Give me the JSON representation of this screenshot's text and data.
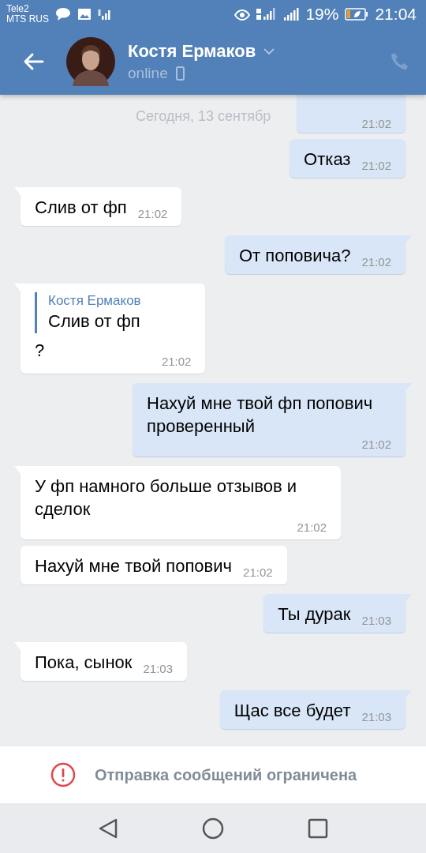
{
  "status_bar": {
    "carriers": [
      "Tele2",
      "MTS RUS"
    ],
    "battery": "19%",
    "time": "21:04"
  },
  "header": {
    "name": "Костя Ермаков",
    "status": "online"
  },
  "date_label": "Сегодня, 13 сентябр",
  "messages": [
    {
      "outgoing": true,
      "time": "21:02",
      "partial": true
    },
    {
      "outgoing": true,
      "text": "Отказ",
      "time": "21:02",
      "tail": false
    },
    {
      "outgoing": false,
      "text": "Слив от фп",
      "time": "21:02",
      "tail": true
    },
    {
      "outgoing": true,
      "text": "От поповича?",
      "time": "21:02",
      "tail": true
    },
    {
      "outgoing": false,
      "reply": {
        "author": "Костя Ермаков",
        "text": "Слив от фп"
      },
      "text": "?",
      "time": "21:02",
      "tail": true
    },
    {
      "outgoing": true,
      "text": "Нахуй мне твой фп попович проверенный",
      "time": "21:02",
      "tail": true
    },
    {
      "outgoing": false,
      "text": "У фп намного больше отзывов и сделок",
      "time": "21:02",
      "tail": true
    },
    {
      "outgoing": false,
      "text": "Нахуй мне твой попович",
      "time": "21:02",
      "tail": false
    },
    {
      "outgoing": true,
      "text": "Ты дурак",
      "time": "21:03",
      "tail": true
    },
    {
      "outgoing": false,
      "text": "Пока, сынок",
      "time": "21:03",
      "tail": true
    },
    {
      "outgoing": true,
      "text": "Щас все будет",
      "time": "21:03",
      "tail": true
    }
  ],
  "notice": "Отправка сообщений ограничена"
}
